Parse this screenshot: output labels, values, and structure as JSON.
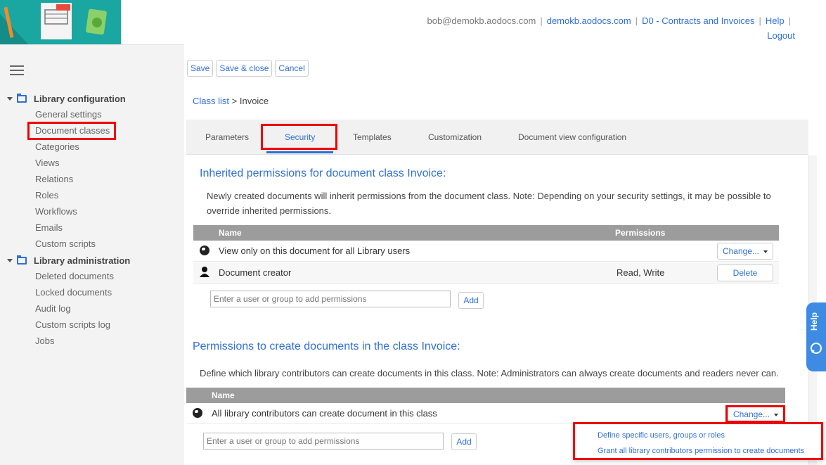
{
  "header": {
    "user_email": "bob@demokb.aodocs.com",
    "domain_link": "demokb.aodocs.com",
    "library_link": "D0 - Contracts and Invoices",
    "help_link": "Help",
    "logout_link": "Logout"
  },
  "sidebar": {
    "section1_title": "Library configuration",
    "section1_items": [
      "General settings",
      "Document classes",
      "Categories",
      "Views",
      "Relations",
      "Roles",
      "Workflows",
      "Emails",
      "Custom scripts"
    ],
    "section2_title": "Library administration",
    "section2_items": [
      "Deleted documents",
      "Locked documents",
      "Audit log",
      "Custom scripts log",
      "Jobs"
    ]
  },
  "toolbar": {
    "save": "Save",
    "save_close": "Save & close",
    "cancel": "Cancel"
  },
  "breadcrumb": {
    "link": "Class list",
    "separator": ">",
    "current": "Invoice"
  },
  "tabs": [
    "Parameters",
    "Security",
    "Templates",
    "Customization",
    "Document view configuration"
  ],
  "inherited": {
    "title": "Inherited permissions for document class Invoice:",
    "description": "Newly created documents will inherit permissions from the document class. Note: Depending on your security settings, it may be possible to override inherited permissions.",
    "col_name": "Name",
    "col_permissions": "Permissions",
    "rows": [
      {
        "name": "View only on this document for all Library users",
        "permissions": "",
        "action": "Change..."
      },
      {
        "name": "Document creator",
        "permissions": "Read, Write",
        "action": "Delete"
      }
    ],
    "add_placeholder": "Enter a user or group to add permissions",
    "add_button": "Add"
  },
  "create": {
    "title": "Permissions to create documents in the class Invoice:",
    "description": "Define which library contributors can create documents in this class. Note: Administrators can always create documents and readers never can.",
    "col_name": "Name",
    "rows": [
      {
        "name": "All library contributors can create document in this class",
        "action": "Change..."
      }
    ],
    "add_placeholder": "Enter a user or group to add permissions",
    "add_button": "Add"
  },
  "dropdown_menu": [
    "Define specific users, groups or roles",
    "Grant all library contributors permission to create documents"
  ],
  "help_tab": "Help",
  "colors": {
    "accent": "#2f6fd6",
    "highlight": "#e00000",
    "header_bg": "#9c9c9c",
    "logo_bg": "#1aa7a1"
  }
}
